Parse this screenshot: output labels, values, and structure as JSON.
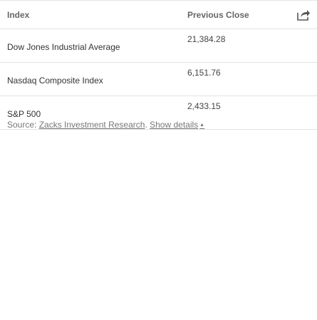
{
  "table": {
    "headers": {
      "index": "Index",
      "previous_close": "Previous Close"
    },
    "rows": [
      {
        "name": "Dow Jones Industrial Average",
        "value": "21,384.28"
      },
      {
        "name": "Nasdaq Composite Index",
        "value": "6,151.76"
      },
      {
        "name": "S&P 500",
        "value": "2,433.15"
      }
    ]
  },
  "source": {
    "prefix": "Source:",
    "link": "Zacks Investment Research",
    "separator": ".",
    "details": "Show details",
    "caret": "▲"
  },
  "icons": {
    "share": "share-icon"
  }
}
